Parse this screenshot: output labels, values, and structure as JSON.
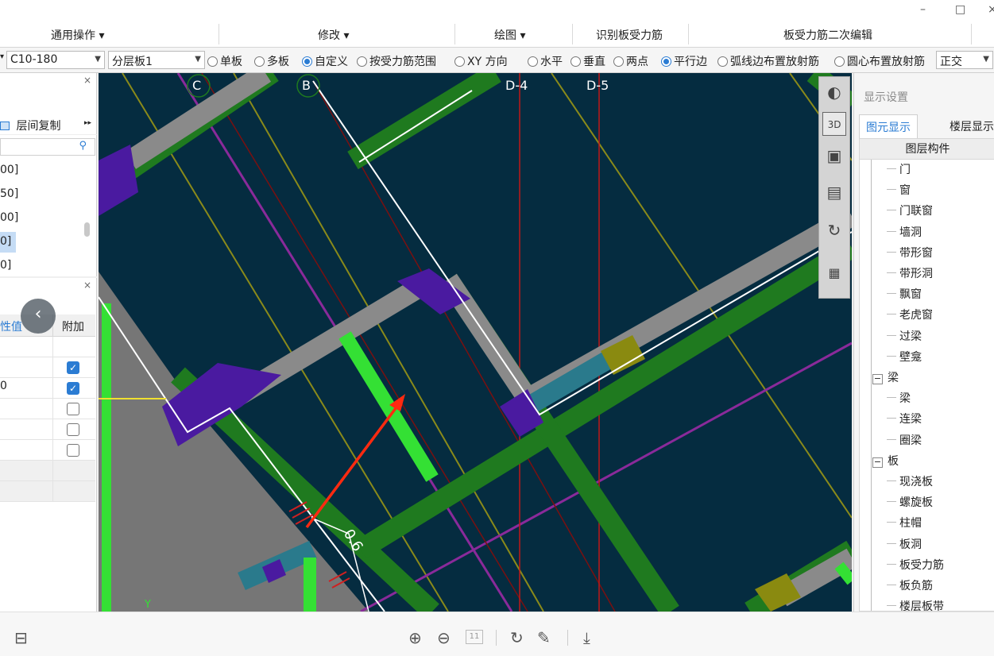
{
  "window": {
    "minimize": "–",
    "maximize": "□",
    "close": "×"
  },
  "ribbon": {
    "tabs": [
      "通用操作 ▾",
      "修改 ▾",
      "绘图 ▾",
      "识别板受力筋",
      "板受力筋二次编辑"
    ]
  },
  "options": {
    "rebar_value": "C10-180",
    "layer_value": "分层板1",
    "radios": [
      {
        "label": "单板",
        "checked": false
      },
      {
        "label": "多板",
        "checked": false
      },
      {
        "label": "自定义",
        "checked": true
      },
      {
        "label": "按受力筋范围",
        "checked": false
      },
      {
        "label": "XY 方向",
        "checked": false
      },
      {
        "label": "水平",
        "checked": false
      },
      {
        "label": "垂直",
        "checked": false
      },
      {
        "label": "两点",
        "checked": false
      },
      {
        "label": "平行边",
        "checked": true
      },
      {
        "label": "弧线边布置放射筋",
        "checked": false
      },
      {
        "label": "圆心布置放射筋",
        "checked": false
      }
    ],
    "mode_value": "正交"
  },
  "left_panel_1": {
    "copy_button": "层间复制",
    "more": "▸▸",
    "items": [
      "00]",
      "50]",
      "00]",
      "0]",
      "0]"
    ]
  },
  "left_panel_2": {
    "col_value": "性值",
    "col_extra": "附加",
    "value_row": "0",
    "checks": [
      true,
      true,
      false,
      false,
      false
    ]
  },
  "canvas": {
    "axis_labels": [
      "C",
      "B",
      "D-4",
      "D-5"
    ],
    "dimension": "0.6",
    "axis_y": "Y"
  },
  "right_panel": {
    "title": "显示设置",
    "tabs": [
      "图元显示",
      "楼层显示"
    ],
    "header": "图层构件",
    "items": [
      {
        "label": "门",
        "group": false
      },
      {
        "label": "窗",
        "group": false
      },
      {
        "label": "门联窗",
        "group": false
      },
      {
        "label": "墙洞",
        "group": false
      },
      {
        "label": "带形窗",
        "group": false
      },
      {
        "label": "带形洞",
        "group": false
      },
      {
        "label": "飘窗",
        "group": false
      },
      {
        "label": "老虎窗",
        "group": false
      },
      {
        "label": "过梁",
        "group": false
      },
      {
        "label": "壁龛",
        "group": false
      },
      {
        "label": "梁",
        "group": true
      },
      {
        "label": "梁",
        "group": false
      },
      {
        "label": "连梁",
        "group": false
      },
      {
        "label": "圈梁",
        "group": false
      },
      {
        "label": "板",
        "group": true
      },
      {
        "label": "现浇板",
        "group": false
      },
      {
        "label": "螺旋板",
        "group": false
      },
      {
        "label": "柱帽",
        "group": false
      },
      {
        "label": "板洞",
        "group": false
      },
      {
        "label": "板受力筋",
        "group": false
      },
      {
        "label": "板负筋",
        "group": false
      },
      {
        "label": "楼层板带",
        "group": false
      }
    ]
  },
  "bottom": {
    "page": "11"
  }
}
